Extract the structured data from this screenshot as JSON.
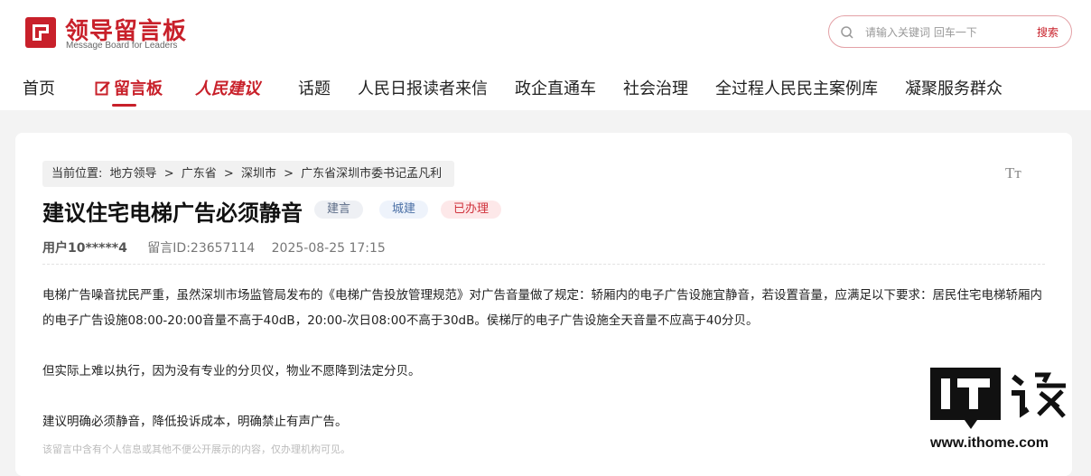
{
  "header": {
    "logo_title": "领导留言板",
    "logo_subtitle": "Message Board for Leaders",
    "search_placeholder": "请输入关键词 回车一下",
    "search_button": "搜索"
  },
  "nav": {
    "items": [
      {
        "label": "首页"
      },
      {
        "label": "留言板"
      },
      {
        "label": "人民建议"
      },
      {
        "label": "话题"
      },
      {
        "label": "人民日报读者来信"
      },
      {
        "label": "政企直通车"
      },
      {
        "label": "社会治理"
      },
      {
        "label": "全过程人民民主案例库"
      },
      {
        "label": "凝聚服务群众"
      }
    ]
  },
  "breadcrumb": {
    "prefix": "当前位置:",
    "parts": [
      "地方领导",
      ">",
      "广东省",
      ">",
      "深圳市",
      ">",
      "广东省深圳市委书记孟凡利"
    ]
  },
  "font_toggle": "Tт",
  "post": {
    "title": "建议住宅电梯广告必须静音",
    "tags": [
      "建言",
      "城建",
      "已办理"
    ],
    "user": "用户10*****4",
    "message_id": "留言ID:23657114",
    "datetime": "2025-08-25 17:15",
    "paragraphs": [
      "电梯广告噪音扰民严重，虽然深圳市场监管局发布的《电梯广告投放管理规范》对广告音量做了规定：轿厢内的电子广告设施宜静音，若设置音量，应满足以下要求：居民住宅电梯轿厢内的电子广告设施08:00-20:00音量不高于40dB，20:00-次日08:00不高于30dB。侯梯厅的电子广告设施全天音量不应高于40分贝。",
      "但实际上难以执行，因为没有专业的分贝仪，物业不愿降到法定分贝。",
      "建议明确必须静音，降低投诉成本，明确禁止有声广告。"
    ],
    "privacy_note": "该留言中含有个人信息或其他不便公开展示的内容，仅办理机构可见。"
  },
  "watermark": {
    "brand": "IT之家",
    "url": "www.ithome.com"
  },
  "colors": {
    "brand_red": "#c8202a",
    "page_bg": "#f3f3f3"
  }
}
